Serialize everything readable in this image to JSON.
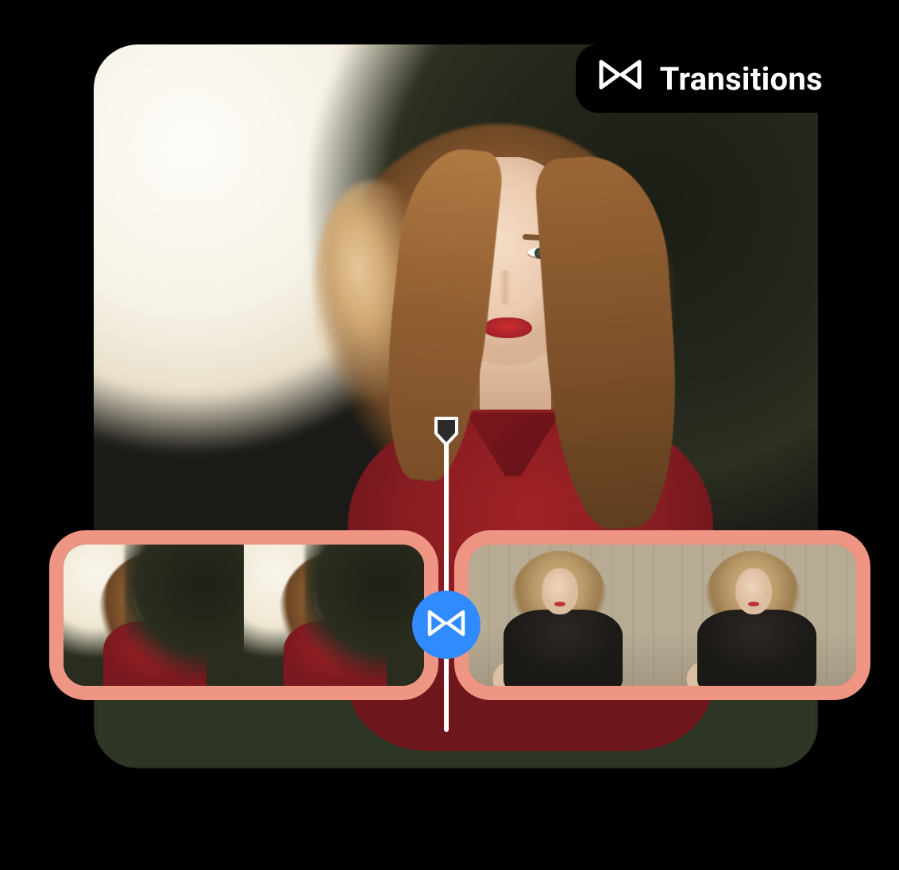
{
  "badge": {
    "label": "Transitions",
    "icon": "bowtie-transition-icon"
  },
  "preview": {
    "description": "Woman with long auburn hair and red lipstick wearing a red top, outdoor backlit park scene"
  },
  "playhead": {
    "marker": "playhead-marker"
  },
  "timeline": {
    "clip_border_color": "#ef9584",
    "clip_a": {
      "description": "Same woman in red top, park backlight",
      "thumbnails": 2
    },
    "clip_b": {
      "description": "Blonde woman in black oversized jacket seated by stone balustrade",
      "thumbnails": 2
    },
    "transition_node": {
      "icon": "bowtie-transition-icon",
      "bg_color": "#2f8bff"
    }
  }
}
